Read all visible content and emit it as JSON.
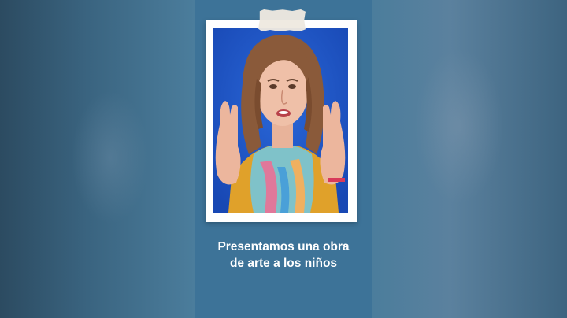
{
  "caption": {
    "line1": "Presentamos una obra",
    "line2": "de arte a los niños"
  },
  "colors": {
    "panel": "#3d7398",
    "photo_background": "#1e56c6",
    "frame": "#ffffff",
    "caption_text": "#ffffff"
  }
}
